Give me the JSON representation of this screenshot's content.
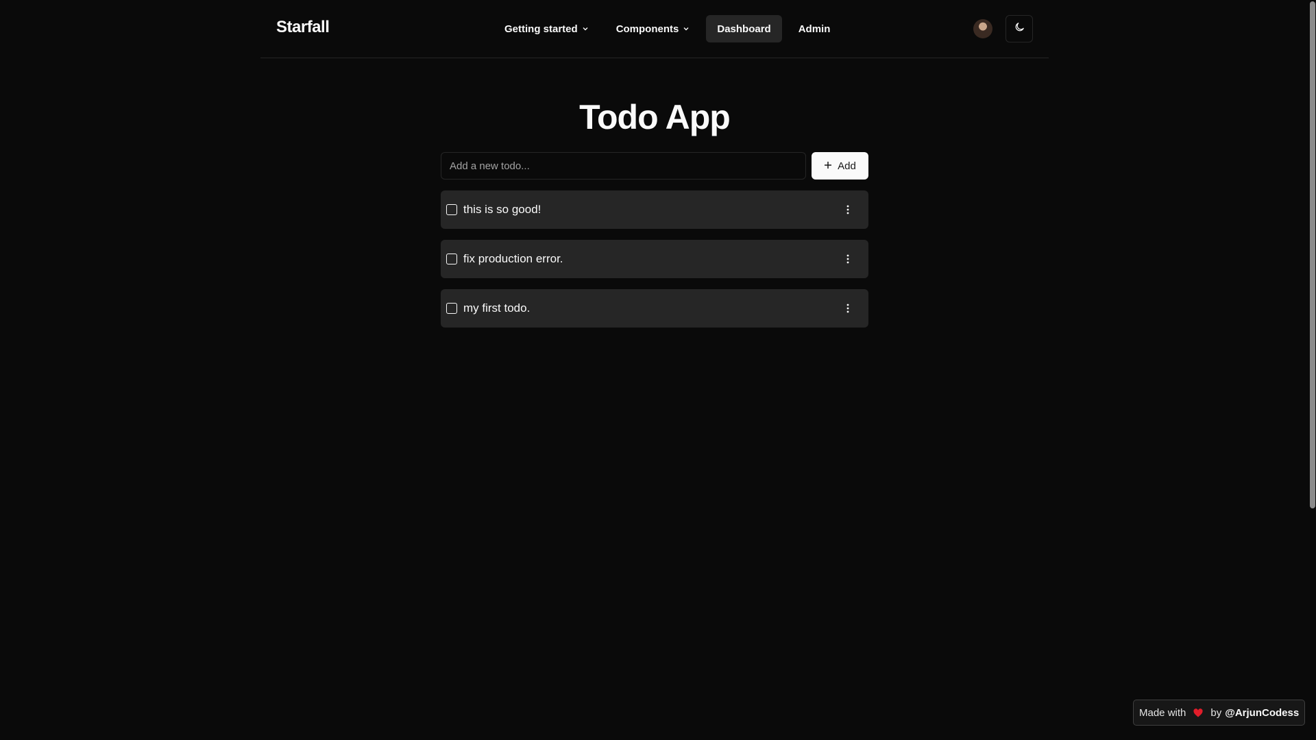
{
  "header": {
    "brand": "Starfall",
    "nav": [
      {
        "label": "Getting started",
        "dropdown": true
      },
      {
        "label": "Components",
        "dropdown": true
      },
      {
        "label": "Dashboard",
        "active": true
      },
      {
        "label": "Admin"
      }
    ],
    "theme_icon": "moon-icon"
  },
  "main": {
    "title": "Todo App",
    "input_placeholder": "Add a new todo...",
    "add_label": "Add",
    "todos": [
      {
        "text": "this is so good!",
        "done": false
      },
      {
        "text": "fix production error.",
        "done": false
      },
      {
        "text": "my first todo.",
        "done": false
      }
    ]
  },
  "footer": {
    "made_with": "Made with",
    "by": "by",
    "handle": "@ArjunCodess"
  },
  "colors": {
    "background": "#0a0a0a",
    "surface": "#262626",
    "foreground": "#fafafa",
    "heart": "#e11d2a"
  }
}
